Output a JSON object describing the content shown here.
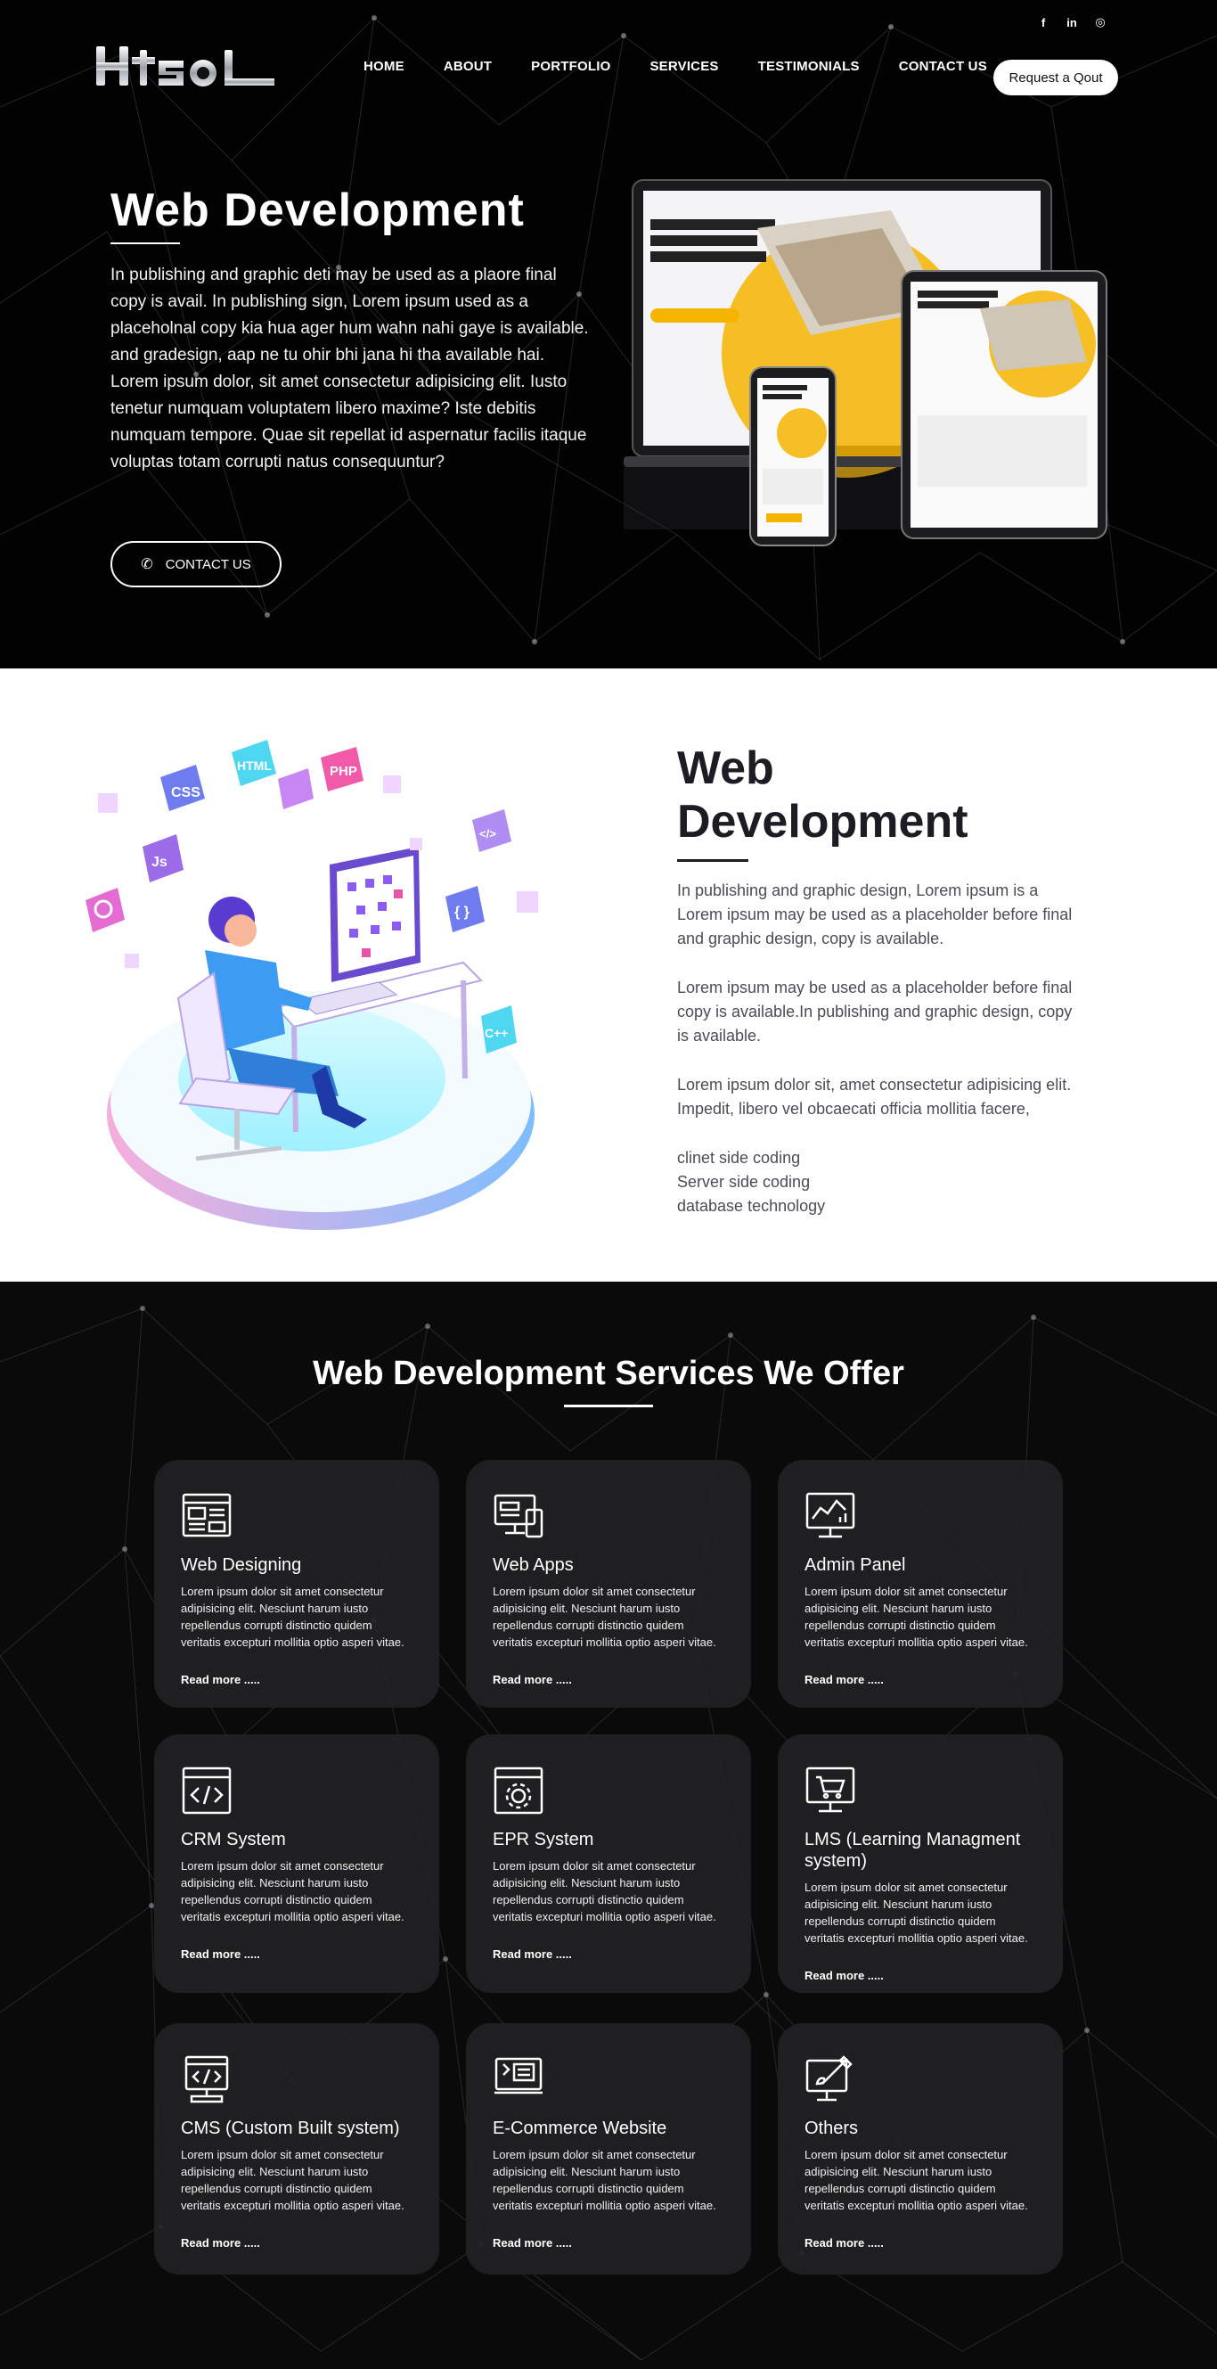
{
  "header": {
    "social": [
      "f",
      "in",
      "◎"
    ],
    "logo_text": "Htsol",
    "nav": [
      "HOME",
      "ABOUT",
      "PORTFOLIO",
      "SERVICES",
      "TESTIMONIALS",
      "CONTACT US"
    ],
    "quote_button": "Request a Qout"
  },
  "hero": {
    "title": "Web Development",
    "text": "In publishing and graphic deti may be used as a plaore final copy is avail. In publishing sign, Lorem ipsum used as a placeholnal copy kia hua ager hum wahn nahi gaye is available. and gradesign, aap ne tu ohir bhi jana hi tha available hai. Lorem ipsum dolor, sit amet consectetur adipisicing elit. Iusto tenetur numquam voluptatem libero maxime? Iste debitis numquam tempore. Quae sit repellat id aspernatur facilis itaque voluptas totam corrupti natus consequuntur?",
    "button": "CONTACT US"
  },
  "about": {
    "title": "Web Development",
    "paragraphs": [
      "In publishing and graphic design, Lorem ipsum is a Lorem ipsum may be used as a placeholder before final and graphic design, copy is available.",
      "Lorem ipsum may be used as a placeholder before final copy is available.In publishing and graphic design, copy is available.",
      "Lorem ipsum dolor sit, amet consectetur adipisicing elit. Impedit, libero vel obcaecati officia mollitia facere,"
    ],
    "features": [
      "clinet side coding",
      "Server side coding",
      "database technology"
    ]
  },
  "services": {
    "title": "Web Development Services We Offer",
    "read_more": "Read more .....",
    "desc": "Lorem ipsum dolor sit amet consectetur adipisicing elit. Nesciunt harum iusto repellendus corrupti distinctio quidem veritatis excepturi mollitia optio asperi vitae.",
    "cards": [
      {
        "title": "Web Designing",
        "icon": "web-design-icon"
      },
      {
        "title": "Web Apps",
        "icon": "web-apps-icon"
      },
      {
        "title": "Admin Panel",
        "icon": "admin-panel-icon"
      },
      {
        "title": "CRM System",
        "icon": "code-icon"
      },
      {
        "title": "EPR System",
        "icon": "gear-icon"
      },
      {
        "title": "LMS (Learning Managment system)",
        "icon": "cart-monitor-icon"
      },
      {
        "title": "CMS (Custom Built system)",
        "icon": "cms-icon"
      },
      {
        "title": "E-Commerce Website",
        "icon": "ecommerce-icon"
      },
      {
        "title": "Others",
        "icon": "design-tools-icon"
      }
    ]
  }
}
